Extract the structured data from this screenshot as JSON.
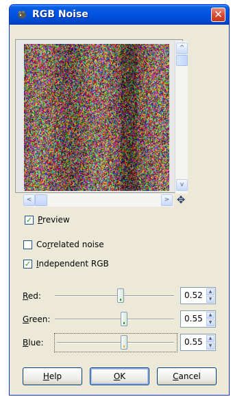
{
  "window": {
    "title": "RGB Noise",
    "close_glyph": "✕"
  },
  "preview": {
    "scroll_up_glyph": "^",
    "scroll_down_glyph": "v",
    "scroll_left_glyph": "<",
    "scroll_right_glyph": ">",
    "navigate_glyph": "✥"
  },
  "options": {
    "preview": {
      "label": "Preview",
      "mnemonic": "P",
      "rest": "review",
      "checked": true
    },
    "correlated": {
      "label": "Correlated noise",
      "pre": "Co",
      "mnemonic": "r",
      "rest": "related noise",
      "checked": false
    },
    "independent": {
      "label": "Independent RGB",
      "mnemonic": "I",
      "rest": "ndependent RGB",
      "checked": true
    }
  },
  "channels": [
    {
      "label": "Red:",
      "mnemonic": "R",
      "rest": "ed:",
      "value": "0.52",
      "level": 0.52
    },
    {
      "label": "Green:",
      "mnemonic": "G",
      "rest": "reen:",
      "value": "0.55",
      "level": 0.55
    },
    {
      "label": "Blue:",
      "mnemonic": "B",
      "rest": "lue:",
      "value": "0.55",
      "level": 0.55
    }
  ],
  "buttons": {
    "help": {
      "label": "Help",
      "mnemonic": "H",
      "rest": "elp"
    },
    "ok": {
      "label": "OK",
      "mnemonic": "O",
      "rest": "K"
    },
    "cancel": {
      "label": "Cancel",
      "mnemonic": "C",
      "rest": "ancel"
    }
  },
  "colors": {
    "titlebar": "#0054e3",
    "close": "#d5452b",
    "check": "#21a121",
    "dialog_bg": "#ece9d8"
  }
}
